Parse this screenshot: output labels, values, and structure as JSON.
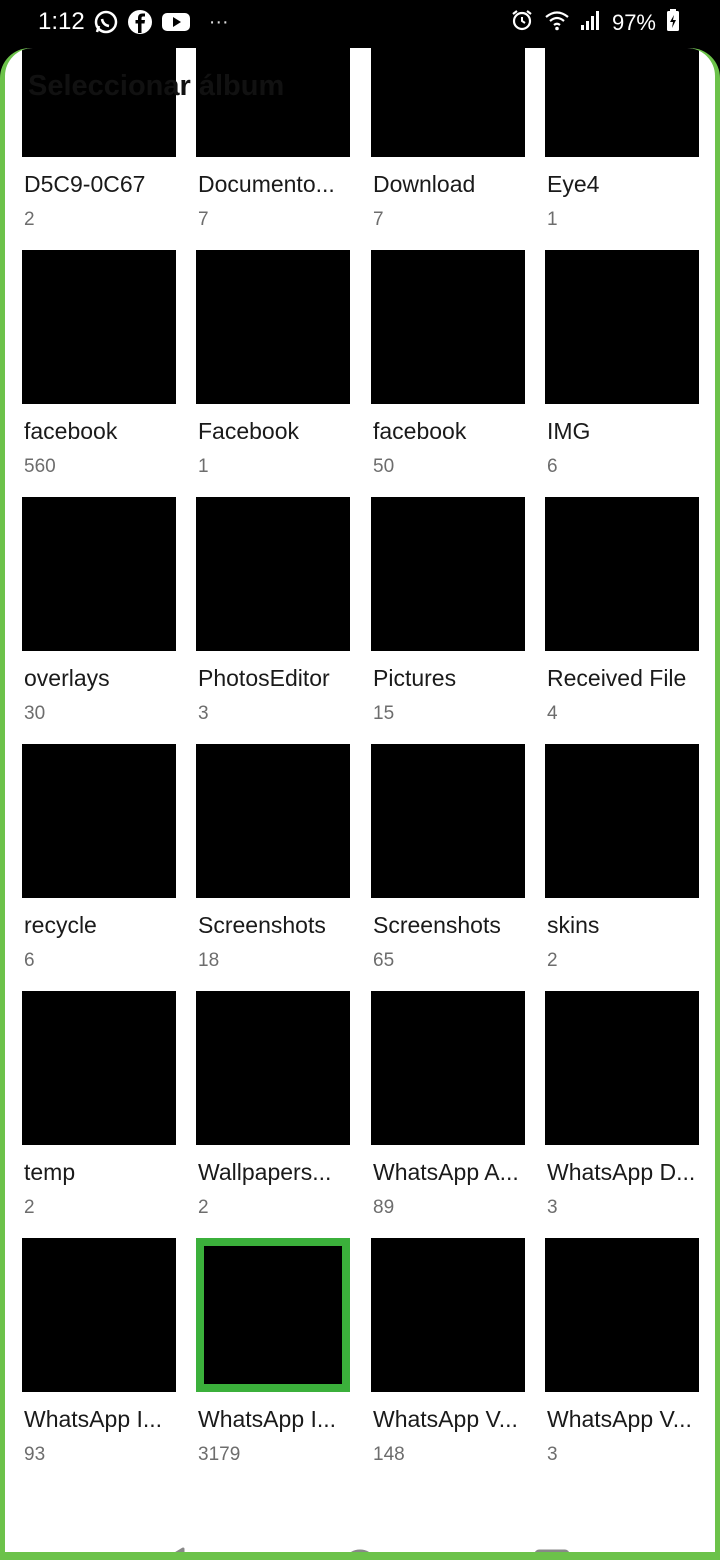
{
  "status_bar": {
    "time": "1:12",
    "battery": "97%",
    "icons": [
      "whatsapp-icon",
      "facebook-icon",
      "youtube-icon",
      "more-dots",
      "alarm-icon",
      "wifi-icon",
      "signal-icon",
      "battery-icon"
    ]
  },
  "sheet": {
    "title": "Seleccionar álbum",
    "accent_color": "#6cc24a",
    "selected_border_color": "#3bb03b"
  },
  "albums": [
    {
      "name": "D5C9-0C67",
      "count": "2"
    },
    {
      "name": "Documento...",
      "count": "7"
    },
    {
      "name": "Download",
      "count": "7"
    },
    {
      "name": "Eye4",
      "count": "1"
    },
    {
      "name": "facebook",
      "count": "560"
    },
    {
      "name": "Facebook",
      "count": "1"
    },
    {
      "name": "facebook",
      "count": "50"
    },
    {
      "name": "IMG",
      "count": "6"
    },
    {
      "name": "overlays",
      "count": "30"
    },
    {
      "name": "PhotosEditor",
      "count": "3"
    },
    {
      "name": "Pictures",
      "count": "15"
    },
    {
      "name": "Received File",
      "count": "4"
    },
    {
      "name": "recycle",
      "count": "6"
    },
    {
      "name": "Screenshots",
      "count": "18"
    },
    {
      "name": "Screenshots",
      "count": "65"
    },
    {
      "name": "skins",
      "count": "2"
    },
    {
      "name": "temp",
      "count": "2"
    },
    {
      "name": "Wallpapers...",
      "count": "2"
    },
    {
      "name": "WhatsApp A...",
      "count": "89"
    },
    {
      "name": "WhatsApp D...",
      "count": "3"
    },
    {
      "name": "WhatsApp I...",
      "count": "93"
    },
    {
      "name": "WhatsApp I...",
      "count": "3179",
      "selected": true
    },
    {
      "name": "WhatsApp V...",
      "count": "148"
    },
    {
      "name": "WhatsApp V...",
      "count": "3"
    }
  ],
  "nav_bar": {
    "buttons": [
      "recents-dot",
      "back-icon",
      "home-icon",
      "overview-icon"
    ]
  }
}
